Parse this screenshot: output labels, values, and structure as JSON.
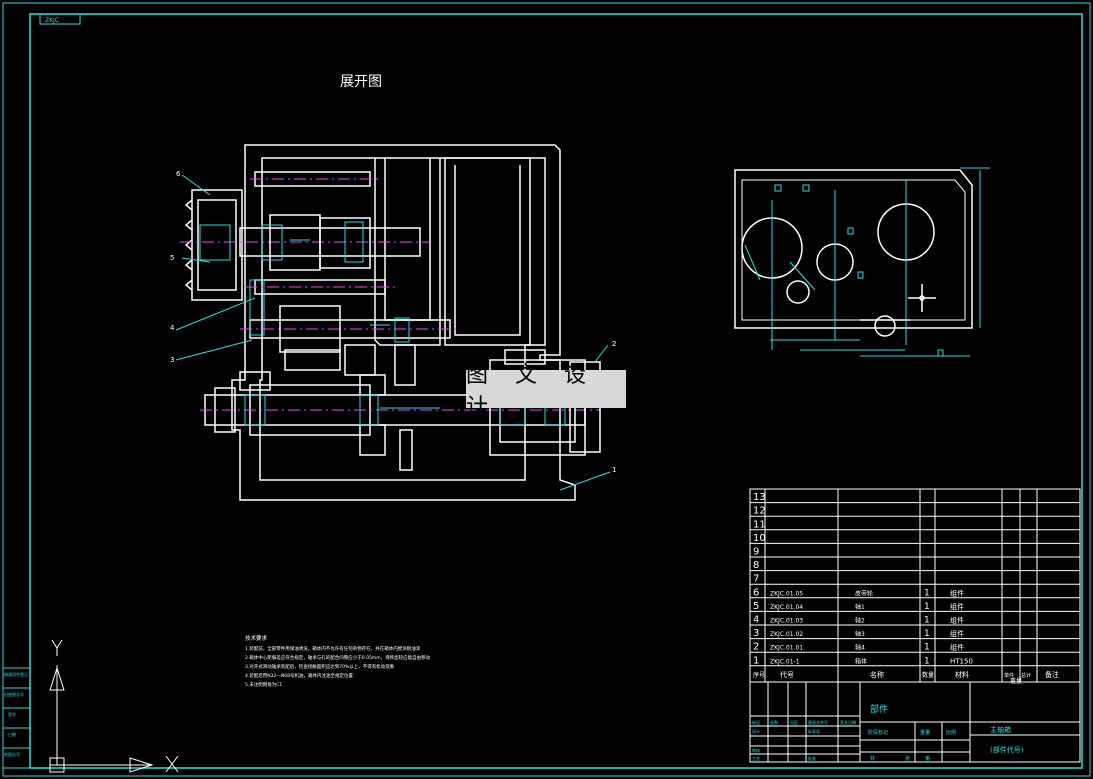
{
  "top_tab": "ZKJC",
  "drawing_title": "展开图",
  "watermark": "图 文 设 计",
  "callouts": [
    "6",
    "5",
    "4",
    "3",
    "2",
    "1"
  ],
  "tech_req": {
    "title": "技术要求",
    "lines": [
      "1.装配前，全部零件用煤油清洗，箱体内不允许有任何杂物存在，并在箱体内壁涂耐油漆",
      "2.箱体中心距偏差应符合规定，轴承与孔的配合间隙应小于0.05mm，滑移齿轮应能自由移动",
      "3.对开式滑动轴承装配后，检查接触面积应达到70%以上，不得有松动现象",
      "4.装配后用N32—N68号机油，箱体内注油至规定位置",
      "5.未注明倒角为C1"
    ]
  },
  "parts_table": {
    "empty_rows": [
      "13",
      "12",
      "11",
      "10",
      "9",
      "8",
      "7"
    ],
    "rows": [
      {
        "no": "6",
        "code": "ZKJC.01.05",
        "name": "皮带轮",
        "qty": "1",
        "material": "组件"
      },
      {
        "no": "5",
        "code": "ZKJC.01.04",
        "name": "轴1",
        "qty": "1",
        "material": "组件"
      },
      {
        "no": "4",
        "code": "ZKJC.01.03",
        "name": "轴2",
        "qty": "1",
        "material": "组件"
      },
      {
        "no": "3",
        "code": "ZKJC.01.02",
        "name": "轴3",
        "qty": "1",
        "material": "组件"
      },
      {
        "no": "2",
        "code": "ZKJC.01.01",
        "name": "轴4",
        "qty": "1",
        "material": "组件"
      },
      {
        "no": "1",
        "code": "ZKJC.01-1",
        "name": "箱体",
        "qty": "1",
        "material": "HT150"
      }
    ],
    "header": {
      "no": "序号",
      "code": "代号",
      "name": "名称",
      "qty": "数量",
      "material": "材料",
      "unit": "单件",
      "total": "总计",
      "weight": "重量",
      "remarks": "备注"
    }
  },
  "title_block": {
    "part_label": "部件",
    "assembly_name": "主轴箱",
    "drawing_code": "(部件代号)",
    "stage_label": "阶段标记",
    "weight_label": "重量",
    "scale_label": "比例",
    "mark_label": "标记",
    "count_label": "处数",
    "zone_label": "分区",
    "change_doc_label": "更改文件号",
    "sign_label": "签名",
    "date_label": "日期",
    "designer_label": "设计",
    "std_label": "标准化",
    "review_label": "审核",
    "process_label": "工艺",
    "approve_label": "批准",
    "sheet_label": "共",
    "page_label": "张",
    "page_of_label": "第"
  },
  "left_strip": [
    "借通用件登记",
    "旧底图总号",
    "签字",
    "日期",
    "底图总号"
  ],
  "axis": {
    "y_label": "Y",
    "x_label": "X"
  },
  "colors": {
    "line": "#ffffff",
    "accent": "#27e0e0",
    "magenta": "#ff3cff",
    "hatch": "#27e0e0"
  }
}
